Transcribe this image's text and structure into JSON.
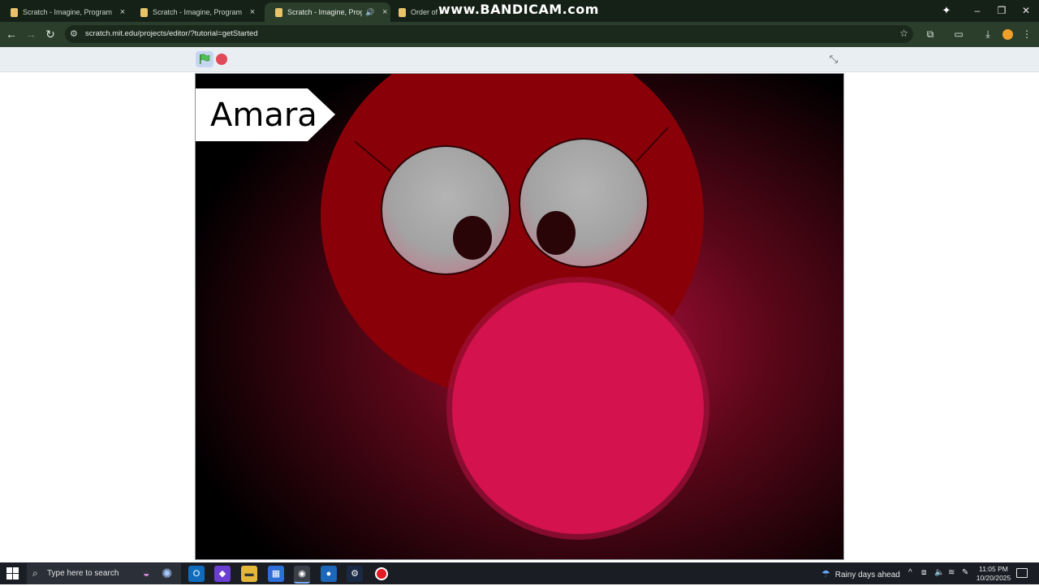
{
  "browser": {
    "tabs": [
      {
        "title": "Scratch - Imagine, Program, Sh",
        "active": false
      },
      {
        "title": "Scratch - Imagine, Program, Sh",
        "active": false
      },
      {
        "title": "Scratch - Imagine, Program",
        "active": true,
        "audio": "speaker-icon"
      },
      {
        "title": "Order of r",
        "active": false
      }
    ],
    "close_glyph": "×",
    "watermark": {
      "main": "www.BANDICAM",
      "suffix": ".com"
    },
    "url": "scratch.mit.edu/projects/editor/?tutorial=getStarted"
  },
  "player": {
    "name_tag": "Amara",
    "colors": {
      "head": "#8a0008",
      "nose": "#d4124e",
      "eye_white": "#a7a7a7",
      "pupil": "#2a0508",
      "tag_bg": "#ffffff"
    }
  },
  "taskbar": {
    "search_placeholder": "Type here to search",
    "weather": "Rainy days ahead",
    "time": "11:05 PM",
    "date": "10/20/2025"
  }
}
